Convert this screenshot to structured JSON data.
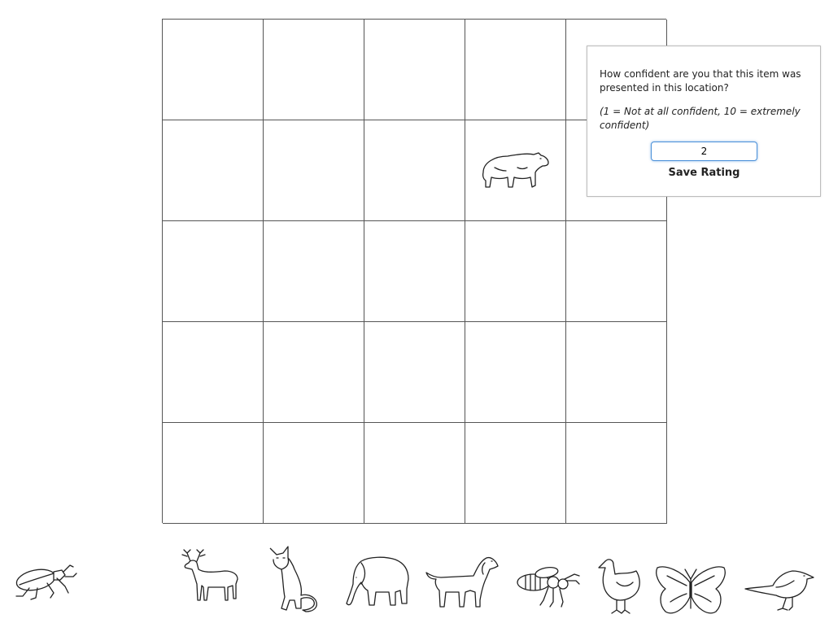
{
  "grid": {
    "rows": 5,
    "columns": 5,
    "placed_item": {
      "name": "bear",
      "row": 2,
      "column": 4
    }
  },
  "rating_popup": {
    "question": "How confident are you that this item was presented in this location?",
    "hint": "(1 = Not at all confident, 10 = extremely confident)",
    "input_value": "2",
    "save_label": "Save Rating"
  },
  "tray": {
    "items": [
      "beetle",
      "deer",
      "cat",
      "elephant",
      "dog",
      "bee",
      "chicken",
      "butterfly",
      "bird"
    ]
  }
}
